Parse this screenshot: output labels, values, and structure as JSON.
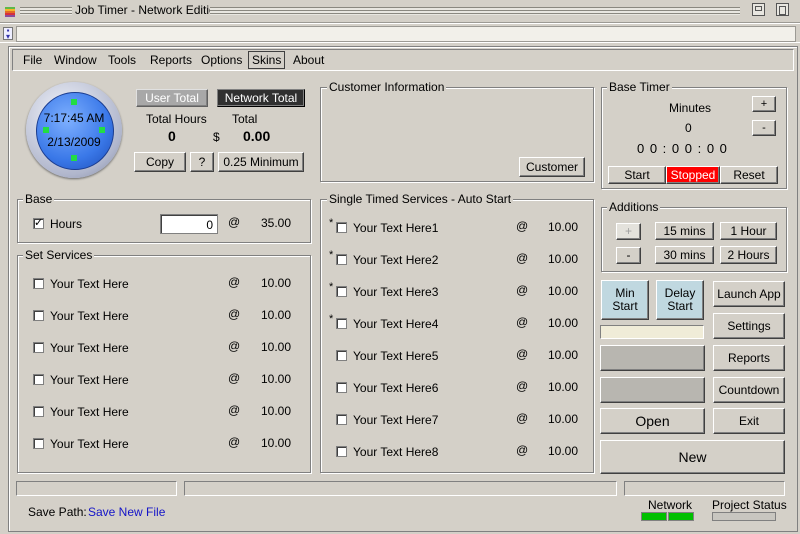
{
  "window": {
    "title": "Job Timer - Network Edition"
  },
  "menu": [
    "File",
    "Window",
    "Tools",
    "Reports",
    "Options",
    "Skins",
    "About"
  ],
  "clock": {
    "time": "7:17:45 AM",
    "date": "2/13/2009"
  },
  "totals": {
    "user_total": "User Total",
    "network_total": "Network Total",
    "total_hours_label": "Total Hours",
    "total_label": "Total",
    "hours_value": "0",
    "currency": "$",
    "amount_value": "0.00",
    "copy": "Copy",
    "help": "?",
    "minimum": "0.25 Minimum"
  },
  "customer": {
    "title": "Customer Information",
    "button": "Customer"
  },
  "base_timer": {
    "title": "Base Timer",
    "minutes_label": "Minutes",
    "minutes_value": "0",
    "plus": "+",
    "minus": "-",
    "display": "0 0 : 0 0 : 0 0",
    "start": "Start",
    "status": "Stopped",
    "reset": "Reset",
    "status_color": "#ff0000"
  },
  "additions": {
    "title": "Additions",
    "plus": "+",
    "minus": "-",
    "b15": "15 mins",
    "b30": "30 mins",
    "b1h": "1 Hour",
    "b2h": "2 Hours"
  },
  "base": {
    "title": "Base",
    "hours_label": "Hours",
    "hours_value": "0",
    "at": "@",
    "rate": "35.00",
    "checked": true
  },
  "set_services": {
    "title": "Set Services",
    "items": [
      {
        "label": "Your Text Here",
        "at": "@",
        "rate": "10.00"
      },
      {
        "label": "Your Text Here",
        "at": "@",
        "rate": "10.00"
      },
      {
        "label": "Your Text Here",
        "at": "@",
        "rate": "10.00"
      },
      {
        "label": "Your Text Here",
        "at": "@",
        "rate": "10.00"
      },
      {
        "label": "Your Text Here",
        "at": "@",
        "rate": "10.00"
      },
      {
        "label": "Your Text Here",
        "at": "@",
        "rate": "10.00"
      }
    ]
  },
  "single_services": {
    "title": "Single Timed Services - Auto Start",
    "items": [
      {
        "star": "*",
        "label": "Your Text Here1",
        "at": "@",
        "rate": "10.00"
      },
      {
        "star": "*",
        "label": "Your Text Here2",
        "at": "@",
        "rate": "10.00"
      },
      {
        "star": "*",
        "label": "Your Text Here3",
        "at": "@",
        "rate": "10.00"
      },
      {
        "star": "*",
        "label": "Your Text Here4",
        "at": "@",
        "rate": "10.00"
      },
      {
        "star": "",
        "label": "Your Text Here5",
        "at": "@",
        "rate": "10.00"
      },
      {
        "star": "",
        "label": "Your Text Here6",
        "at": "@",
        "rate": "10.00"
      },
      {
        "star": "",
        "label": "Your Text Here7",
        "at": "@",
        "rate": "10.00"
      },
      {
        "star": "",
        "label": "Your Text Here8",
        "at": "@",
        "rate": "10.00"
      }
    ]
  },
  "side": {
    "min_start": [
      "Min",
      "Start"
    ],
    "delay_start": [
      "Delay",
      "Start"
    ],
    "launch_app": "Launch App",
    "settings": "Settings",
    "reports": "Reports",
    "countdown": "Countdown",
    "open": "Open",
    "exit": "Exit",
    "new": "New"
  },
  "footer": {
    "save_path_label": "Save Path:",
    "save_new_file": "Save New File",
    "network_label": "Network",
    "project_status_label": "Project Status",
    "network_color": "#00c000"
  }
}
